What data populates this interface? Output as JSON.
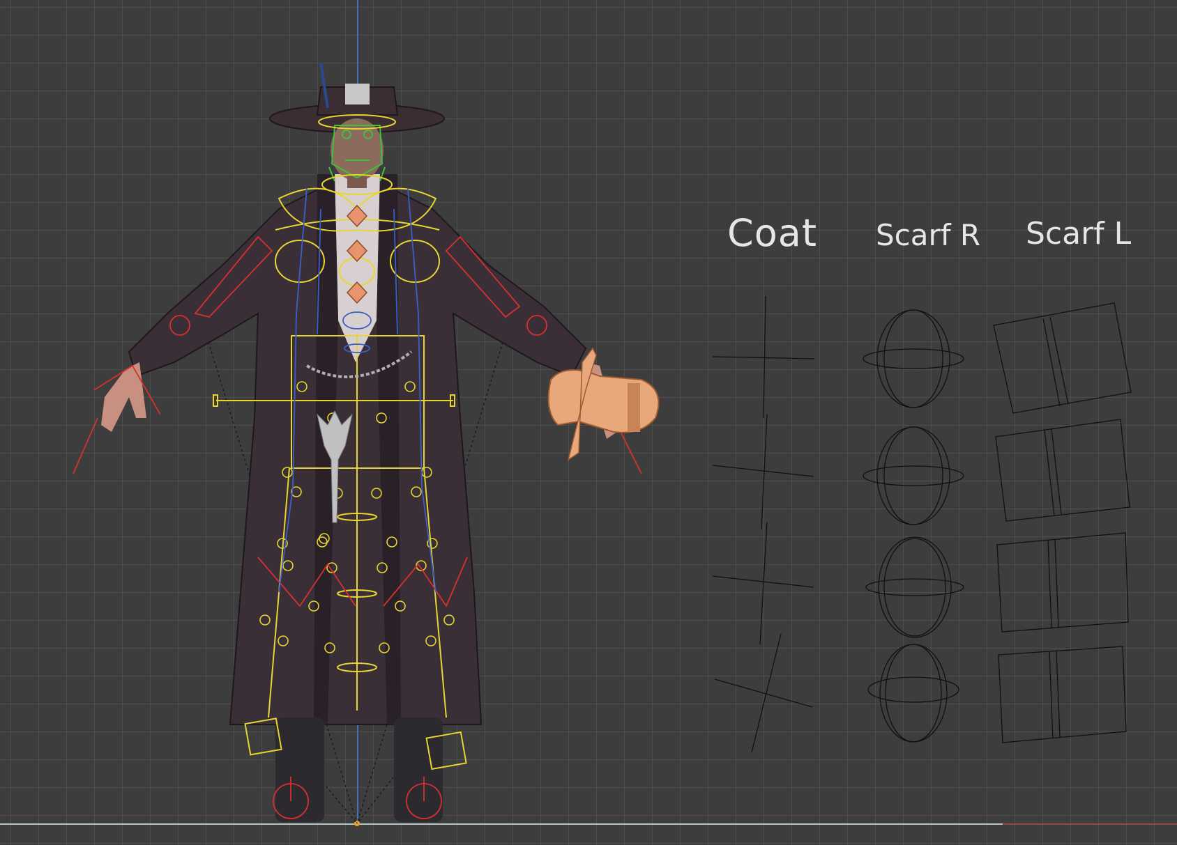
{
  "viewport": {
    "background_color": "#3d3d3d",
    "grid_color": "#5a5a5a",
    "axis_colors": {
      "z": "#4a6fb8",
      "x": "#b9c6c6",
      "x_negative": "#9a4646"
    }
  },
  "labels": {
    "coat": "Coat",
    "scarf_r": "Scarf R",
    "scarf_l": "Scarf L"
  },
  "rig": {
    "bone_colors": {
      "center": "#e8d630",
      "left": "#d83030",
      "right": "#3a5fc8",
      "face": "#3fc03f",
      "selected": "#f0a070"
    }
  },
  "widget_columns": [
    {
      "name": "Coat",
      "shape": "cross",
      "count": 4
    },
    {
      "name": "Scarf R",
      "shape": "sphere",
      "count": 4
    },
    {
      "name": "Scarf L",
      "shape": "cube",
      "count": 4
    }
  ]
}
